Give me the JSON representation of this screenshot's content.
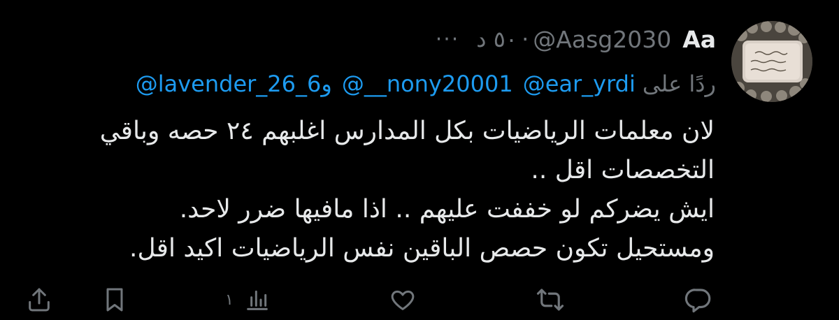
{
  "author": {
    "display_name": "Aa",
    "handle": "@Aasg2030",
    "dot": "·",
    "time": "٥٠ د",
    "more": "···"
  },
  "reply": {
    "label": "ردًا على",
    "mentions": [
      "@ear_yrdi",
      "@__nony20001",
      "و",
      "@lavender_26_6"
    ]
  },
  "body_lines": [
    "لان معلمات الرياضيات بكل المدارس اغلبهم ٢٤ حصه وباقي",
    "التخصصات اقل ..",
    "ايش يضركم لو خففت عليهم .. اذا مافيها ضرر لاحد.",
    "ومستحيل تكون حصص الباقين نفس الرياضيات اكيد اقل."
  ],
  "actions": {
    "views_count": "١",
    "icons": [
      "share-icon",
      "bookmark-icon",
      "views-icon",
      "like-icon",
      "retweet-icon",
      "reply-icon"
    ]
  },
  "colors": {
    "background": "#000000",
    "text": "#e7e9ea",
    "secondary": "#71767b",
    "link": "#1d9bf0"
  }
}
